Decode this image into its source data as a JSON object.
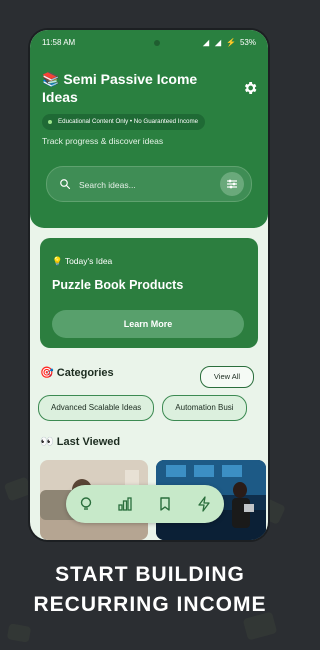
{
  "status_bar": {
    "time": "11:58 AM",
    "battery": "53%",
    "bolt": "⚡"
  },
  "header": {
    "title_emoji": "📚",
    "title": "Semi Passive Icome Ideas",
    "disclaimer": "Educational Content Only • No Guaranteed Income",
    "subtitle": "Track progress & discover ideas"
  },
  "search": {
    "placeholder": "Search ideas..."
  },
  "today_card": {
    "label_emoji": "💡",
    "label": "Today's Idea",
    "idea": "Puzzle Book Products",
    "button": "Learn More"
  },
  "categories": {
    "emoji": "🎯",
    "title": "Categories",
    "view_all": "View All",
    "items": [
      "Advanced Scalable Ideas",
      "Automation Busi"
    ]
  },
  "last_viewed": {
    "emoji": "👀",
    "title": "Last Viewed"
  },
  "bottom_nav": [
    "lightbulb-icon",
    "bar-chart-icon",
    "bookmark-icon",
    "lightning-icon"
  ],
  "tagline": {
    "line1": "START BUILDING",
    "line2": "RECURRING INCOME"
  },
  "colors": {
    "primary": "#2a8040",
    "card": "#2c7e3f",
    "background": "#eaf4ea",
    "outer": "#2b2e32"
  }
}
